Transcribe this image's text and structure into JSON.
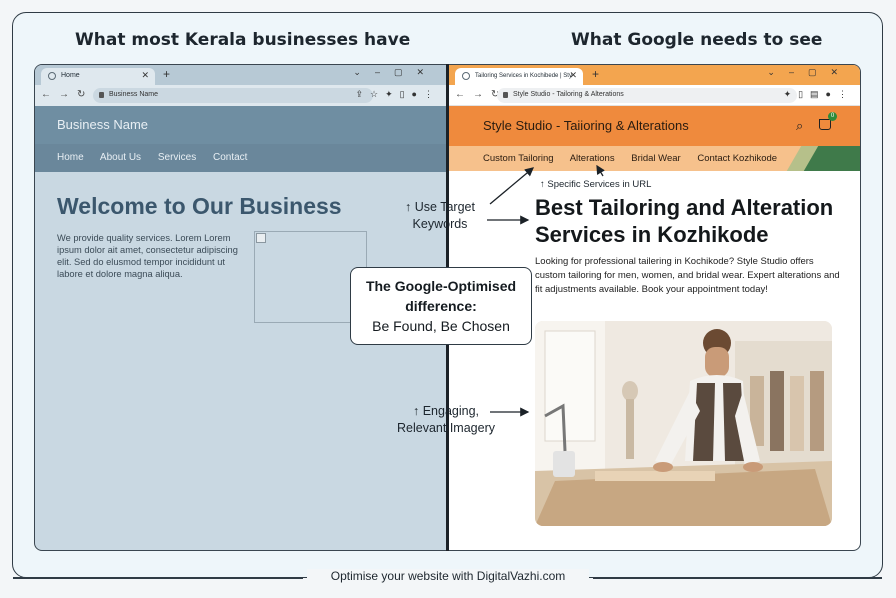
{
  "headings": {
    "left": "What most Kerala businesses have",
    "right": "What Google needs to see"
  },
  "left_browser": {
    "tab_title": "Home",
    "address": "Business Name",
    "site": {
      "brand": "Business Name",
      "nav": [
        "Home",
        "About Us",
        "Services",
        "Contact"
      ],
      "headline": "Welcome to Our Business",
      "body": "We provide quality services. Lorem Lorem ipsum dolor ait amet, consectetur adipiscing elit. Sed do elusmod tempor incididunt ut labore et dolore magna aliqua."
    }
  },
  "right_browser": {
    "tab_title": "Tailoring Services in Kochibede | Sty",
    "address": "Style Studio - Tailoring & Alterations",
    "site": {
      "brand": "Style Studio - Taiioring & Alterations",
      "cart_count": "0",
      "nav": [
        "Custom Tailoring",
        "Alterations",
        "Bridal Wear",
        "Contact Kozhikode"
      ],
      "headline": "Best Tailoring and Alteration Services in Kozhikode",
      "body": "Looking for professional tailering in Kochikode? Style Studio offers custom tailoring for men, women, and bridal wear. Expert alterations and fit adjustments available. Book your appointment today!"
    }
  },
  "annotations": {
    "url_note": "↑ Specific Services in URL",
    "keywords_line1": "↑ Use Target",
    "keywords_line2": "Keywords",
    "imagery_line1": "↑ Engaging,",
    "imagery_line2": "Relevant Imagery",
    "callout_line1": "The Google-Optimised",
    "callout_line2": "difference:",
    "callout_line3": "Be Found, Be Chosen"
  },
  "footer": "Optimise your website with DigitalVazhi.com",
  "colors": {
    "left_header": "#6f8ea2",
    "right_header": "#ef8a3d",
    "right_nav": "#f6c18c",
    "accent_green": "#3f7a4a"
  }
}
